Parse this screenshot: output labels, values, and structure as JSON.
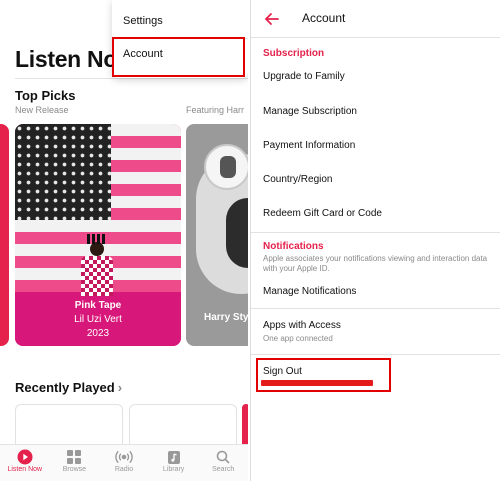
{
  "left": {
    "page_title": "Listen Now",
    "top_picks": {
      "title": "Top Picks",
      "new_release_label": "New Release",
      "featuring_label": "Featuring Harr",
      "album": {
        "name": "Pink Tape",
        "artist": "Lil Uzi Vert",
        "year": "2023"
      },
      "second_card_label": "Harry Styl"
    },
    "recently_played": {
      "title": "Recently Played",
      "chevron": "›"
    },
    "popup": {
      "settings": "Settings",
      "account": "Account"
    },
    "tabs": [
      {
        "label": "Listen Now",
        "icon": "play-circle-icon",
        "active": true
      },
      {
        "label": "Browse",
        "icon": "grid-icon",
        "active": false
      },
      {
        "label": "Radio",
        "icon": "radio-icon",
        "active": false
      },
      {
        "label": "Library",
        "icon": "library-icon",
        "active": false
      },
      {
        "label": "Search",
        "icon": "search-icon",
        "active": false
      }
    ]
  },
  "right": {
    "header": {
      "title": "Account",
      "back_icon": "arrow-left-icon"
    },
    "subscription": {
      "title": "Subscription",
      "items": [
        "Upgrade to Family",
        "Manage Subscription",
        "Payment Information",
        "Country/Region",
        "Redeem Gift Card or Code"
      ]
    },
    "notifications": {
      "title": "Notifications",
      "note": "Apple associates your notifications viewing and interaction data with your Apple ID.",
      "item": "Manage Notifications"
    },
    "apps_with_access": {
      "label": "Apps with Access",
      "sub": "One app connected"
    },
    "sign_out": "Sign Out"
  },
  "colors": {
    "accent": "#e4224b",
    "highlight": "#e30000"
  }
}
